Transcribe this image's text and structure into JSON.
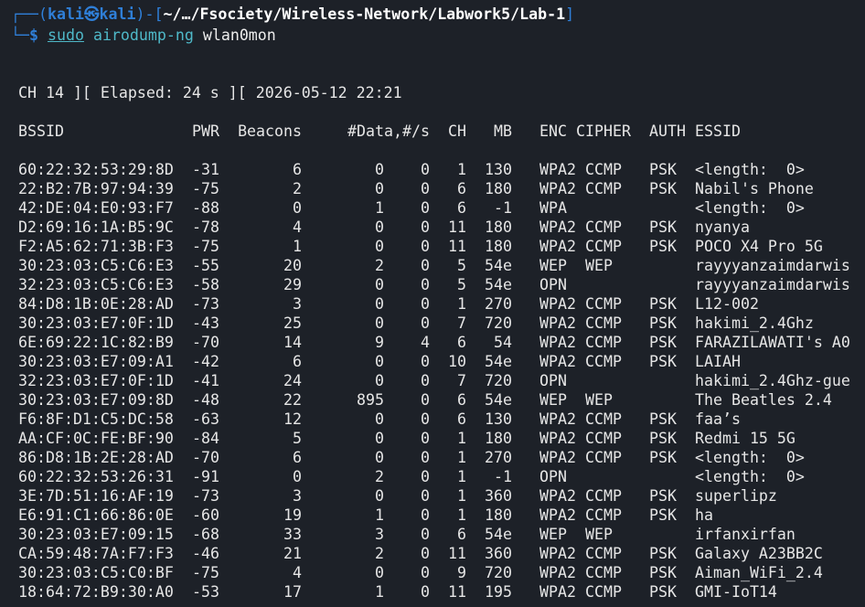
{
  "prompt": {
    "open": "┌──(",
    "user": "kali",
    "at": "㉿",
    "host": "kali",
    "mid": ")-[",
    "cwd": "~/…/Fsociety/Wireless-Network/Labwork5/Lab-1",
    "close": "]",
    "corner": "└─",
    "dollar": "$",
    "sudo": "sudo",
    "program": "airodump-ng",
    "argument": "wlan0mon"
  },
  "status_line": "CH 14 ][ Elapsed: 24 s ][ 2026-05-12 22:21",
  "table": {
    "headers": {
      "bssid": "BSSID",
      "pwr": "PWR",
      "beacons": "Beacons",
      "data": "#Data,",
      "per_s": "#/s",
      "ch": "CH",
      "mb": "MB",
      "enc": "ENC",
      "cipher": "CIPHER",
      "auth": "AUTH",
      "essid": "ESSID"
    },
    "rows": [
      {
        "bssid": "60:22:32:53:29:8D",
        "pwr": "-31",
        "beacons": "6",
        "data": "0",
        "per_s": "0",
        "ch": "1",
        "mb": "130",
        "enc": "WPA2",
        "cipher": "CCMP",
        "auth": "PSK",
        "essid": "<length:  0>"
      },
      {
        "bssid": "22:B2:7B:97:94:39",
        "pwr": "-75",
        "beacons": "2",
        "data": "0",
        "per_s": "0",
        "ch": "6",
        "mb": "180",
        "enc": "WPA2",
        "cipher": "CCMP",
        "auth": "PSK",
        "essid": "Nabil's Phone"
      },
      {
        "bssid": "42:DE:04:E0:93:F7",
        "pwr": "-88",
        "beacons": "0",
        "data": "1",
        "per_s": "0",
        "ch": "6",
        "mb": "-1",
        "enc": "WPA",
        "cipher": "",
        "auth": "",
        "essid": "<length:  0>"
      },
      {
        "bssid": "D2:69:16:1A:B5:9C",
        "pwr": "-78",
        "beacons": "4",
        "data": "0",
        "per_s": "0",
        "ch": "11",
        "mb": "180",
        "enc": "WPA2",
        "cipher": "CCMP",
        "auth": "PSK",
        "essid": "nyanya"
      },
      {
        "bssid": "F2:A5:62:71:3B:F3",
        "pwr": "-75",
        "beacons": "1",
        "data": "0",
        "per_s": "0",
        "ch": "11",
        "mb": "180",
        "enc": "WPA2",
        "cipher": "CCMP",
        "auth": "PSK",
        "essid": "POCO X4 Pro 5G"
      },
      {
        "bssid": "30:23:03:C5:C6:E3",
        "pwr": "-55",
        "beacons": "20",
        "data": "2",
        "per_s": "0",
        "ch": "5",
        "mb": "54e",
        "enc": "WEP",
        "cipher": "WEP",
        "auth": "",
        "essid": "rayyyanzaimdarwis"
      },
      {
        "bssid": "32:23:03:C5:C6:E3",
        "pwr": "-58",
        "beacons": "29",
        "data": "0",
        "per_s": "0",
        "ch": "5",
        "mb": "54e",
        "enc": "OPN",
        "cipher": "",
        "auth": "",
        "essid": "rayyyanzaimdarwis"
      },
      {
        "bssid": "84:D8:1B:0E:28:AD",
        "pwr": "-73",
        "beacons": "3",
        "data": "0",
        "per_s": "0",
        "ch": "1",
        "mb": "270",
        "enc": "WPA2",
        "cipher": "CCMP",
        "auth": "PSK",
        "essid": "L12-002"
      },
      {
        "bssid": "30:23:03:E7:0F:1D",
        "pwr": "-43",
        "beacons": "25",
        "data": "0",
        "per_s": "0",
        "ch": "7",
        "mb": "720",
        "enc": "WPA2",
        "cipher": "CCMP",
        "auth": "PSK",
        "essid": "hakimi_2.4Ghz"
      },
      {
        "bssid": "6E:69:22:1C:82:B9",
        "pwr": "-70",
        "beacons": "14",
        "data": "9",
        "per_s": "4",
        "ch": "6",
        "mb": "54",
        "enc": "WPA2",
        "cipher": "CCMP",
        "auth": "PSK",
        "essid": "FARAZILAWATI's A0"
      },
      {
        "bssid": "30:23:03:E7:09:A1",
        "pwr": "-42",
        "beacons": "6",
        "data": "0",
        "per_s": "0",
        "ch": "10",
        "mb": "54e",
        "enc": "WPA2",
        "cipher": "CCMP",
        "auth": "PSK",
        "essid": "LAIAH"
      },
      {
        "bssid": "32:23:03:E7:0F:1D",
        "pwr": "-41",
        "beacons": "24",
        "data": "0",
        "per_s": "0",
        "ch": "7",
        "mb": "720",
        "enc": "OPN",
        "cipher": "",
        "auth": "",
        "essid": "hakimi_2.4Ghz-gue"
      },
      {
        "bssid": "30:23:03:E7:09:8D",
        "pwr": "-48",
        "beacons": "22",
        "data": "895",
        "per_s": "0",
        "ch": "6",
        "mb": "54e",
        "enc": "WEP",
        "cipher": "WEP",
        "auth": "",
        "essid": "The Beatles 2.4"
      },
      {
        "bssid": "F6:8F:D1:C5:DC:58",
        "pwr": "-63",
        "beacons": "12",
        "data": "0",
        "per_s": "0",
        "ch": "6",
        "mb": "130",
        "enc": "WPA2",
        "cipher": "CCMP",
        "auth": "PSK",
        "essid": "faa’s"
      },
      {
        "bssid": "AA:CF:0C:FE:BF:90",
        "pwr": "-84",
        "beacons": "5",
        "data": "0",
        "per_s": "0",
        "ch": "1",
        "mb": "180",
        "enc": "WPA2",
        "cipher": "CCMP",
        "auth": "PSK",
        "essid": "Redmi 15 5G"
      },
      {
        "bssid": "86:D8:1B:2E:28:AD",
        "pwr": "-70",
        "beacons": "6",
        "data": "0",
        "per_s": "0",
        "ch": "1",
        "mb": "270",
        "enc": "WPA2",
        "cipher": "CCMP",
        "auth": "PSK",
        "essid": "<length:  0>"
      },
      {
        "bssid": "60:22:32:53:26:31",
        "pwr": "-91",
        "beacons": "0",
        "data": "2",
        "per_s": "0",
        "ch": "1",
        "mb": "-1",
        "enc": "OPN",
        "cipher": "",
        "auth": "",
        "essid": "<length:  0>"
      },
      {
        "bssid": "3E:7D:51:16:AF:19",
        "pwr": "-73",
        "beacons": "3",
        "data": "0",
        "per_s": "0",
        "ch": "1",
        "mb": "360",
        "enc": "WPA2",
        "cipher": "CCMP",
        "auth": "PSK",
        "essid": "superlipz"
      },
      {
        "bssid": "E6:91:C1:66:86:0E",
        "pwr": "-60",
        "beacons": "19",
        "data": "1",
        "per_s": "0",
        "ch": "1",
        "mb": "180",
        "enc": "WPA2",
        "cipher": "CCMP",
        "auth": "PSK",
        "essid": "ha"
      },
      {
        "bssid": "30:23:03:E7:09:15",
        "pwr": "-68",
        "beacons": "33",
        "data": "3",
        "per_s": "0",
        "ch": "6",
        "mb": "54e",
        "enc": "WEP",
        "cipher": "WEP",
        "auth": "",
        "essid": "irfanxirfan"
      },
      {
        "bssid": "CA:59:48:7A:F7:F3",
        "pwr": "-46",
        "beacons": "21",
        "data": "2",
        "per_s": "0",
        "ch": "11",
        "mb": "360",
        "enc": "WPA2",
        "cipher": "CCMP",
        "auth": "PSK",
        "essid": "Galaxy A23BB2C"
      },
      {
        "bssid": "30:23:03:C5:C0:BF",
        "pwr": "-75",
        "beacons": "4",
        "data": "0",
        "per_s": "0",
        "ch": "9",
        "mb": "720",
        "enc": "WPA2",
        "cipher": "CCMP",
        "auth": "PSK",
        "essid": "Aiman_WiFi_2.4"
      },
      {
        "bssid": "18:64:72:B9:30:A0",
        "pwr": "-53",
        "beacons": "17",
        "data": "1",
        "per_s": "0",
        "ch": "11",
        "mb": "195",
        "enc": "WPA2",
        "cipher": "CCMP",
        "auth": "PSK",
        "essid": "GMI-IoT14"
      }
    ]
  },
  "colors": {
    "background": "#1d2128",
    "prompt_blue": "#2f7fd8",
    "command_cyan": "#4fb9c9",
    "text": "#e6e6e6"
  }
}
